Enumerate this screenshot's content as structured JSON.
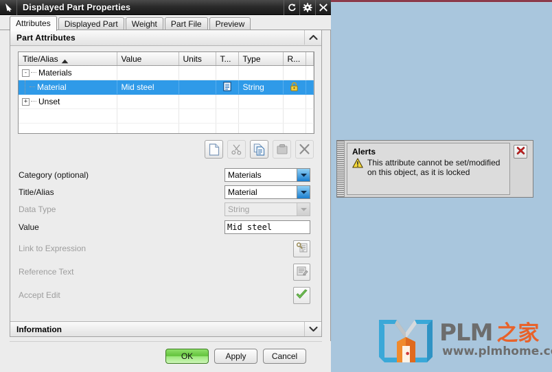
{
  "desktop": {
    "background_color": "#a9c6dd",
    "topline_color": "#8c3a4a"
  },
  "dialog": {
    "title": "Displayed Part Properties",
    "app_icon": "pointer-arrow-icon",
    "title_buttons": [
      {
        "name": "reset-button",
        "icon": "reset-circular-arrow-icon"
      },
      {
        "name": "settings-button",
        "icon": "gear-icon"
      },
      {
        "name": "close-button",
        "icon": "close-x-icon"
      }
    ],
    "tabs": [
      {
        "label": "Attributes",
        "active": true
      },
      {
        "label": "Displayed Part",
        "active": false
      },
      {
        "label": "Weight",
        "active": false
      },
      {
        "label": "Part File",
        "active": false
      },
      {
        "label": "Preview",
        "active": false
      }
    ],
    "section": {
      "title": "Part Attributes",
      "collapse_icon": "chevron-up-icon"
    },
    "table": {
      "columns": [
        "Title/Alias",
        "Value",
        "Units",
        "T...",
        "Type",
        "R...",
        ""
      ],
      "sort_column": "Title/Alias",
      "sort_direction": "ascending",
      "rows": [
        {
          "kind": "group",
          "toggle": "-",
          "title": "Materials",
          "value": "",
          "units": "",
          "t": "",
          "type": "",
          "r": ""
        },
        {
          "kind": "child",
          "selected": true,
          "title": "Material",
          "value": "Mid steel",
          "units": "",
          "t": "document-icon",
          "type": "String",
          "r": "lock-icon"
        },
        {
          "kind": "group",
          "toggle": "+",
          "title": "Unset",
          "value": "",
          "units": "",
          "t": "",
          "type": "",
          "r": ""
        }
      ],
      "selection_color": "#2f9ae8"
    },
    "toolbar": [
      {
        "name": "new-attribute-button",
        "icon": "new-document-icon",
        "enabled": true
      },
      {
        "name": "cut-button",
        "icon": "scissors-icon",
        "enabled": false
      },
      {
        "name": "copy-button",
        "icon": "copy-documents-icon",
        "enabled": true
      },
      {
        "name": "paste-button",
        "icon": "paste-clipboard-icon",
        "enabled": false
      },
      {
        "name": "delete-button",
        "icon": "close-x-icon",
        "enabled": true
      }
    ],
    "form": {
      "category": {
        "label": "Category (optional)",
        "value": "Materials",
        "enabled": true
      },
      "title_alias": {
        "label": "Title/Alias",
        "value": "Material",
        "enabled": true
      },
      "data_type": {
        "label": "Data Type",
        "value": "String",
        "enabled": false
      },
      "value": {
        "label": "Value",
        "value": "Mid steel",
        "enabled": true
      },
      "link_to_expression": {
        "label": "Link to Expression",
        "enabled": false,
        "icon": "key-expression-icon"
      },
      "reference_text": {
        "label": "Reference Text",
        "enabled": false,
        "icon": "edit-text-icon"
      },
      "accept_edit": {
        "label": "Accept Edit",
        "enabled": false,
        "icon": "green-check-icon"
      }
    },
    "information": {
      "label": "Information",
      "expand_icon": "chevron-down-icon"
    },
    "footer": {
      "ok": "OK",
      "apply": "Apply",
      "cancel": "Cancel",
      "ok_color": "#63c23c"
    }
  },
  "alerts": {
    "title": "Alerts",
    "icon": "warning-triangle-icon",
    "message": "This attribute cannot be set/modified on this object, as it is locked",
    "close_icon": "red-x-icon"
  },
  "watermark": {
    "brand": "PLM",
    "brand_cn": "之家",
    "url": "www.plmhome.com",
    "logo_icon": "plm-book-logo-icon",
    "brand_color": "#6d6d6d",
    "accent_color": "#e8622a",
    "book_color": "#3aa8d8"
  }
}
